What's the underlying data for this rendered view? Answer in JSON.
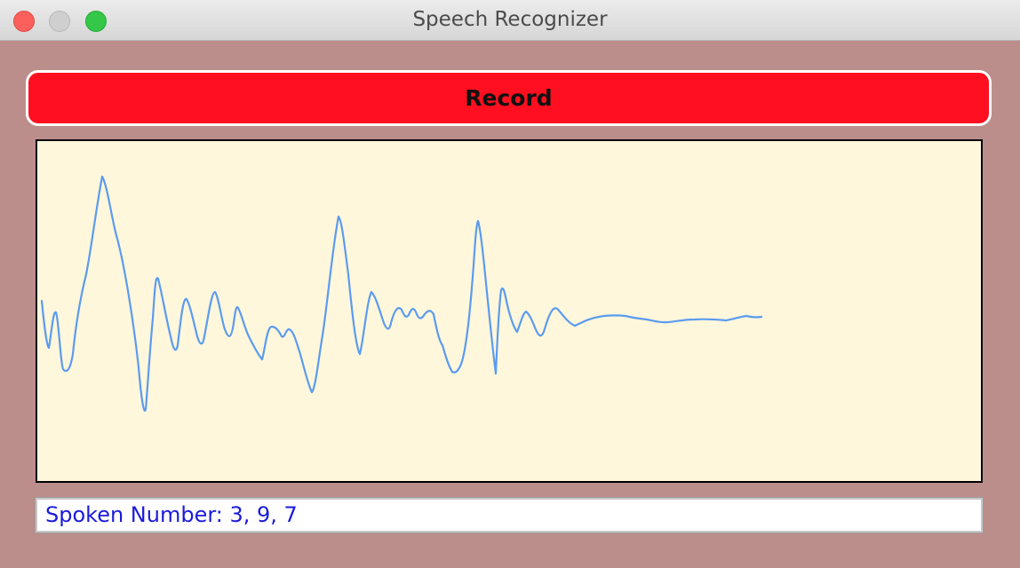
{
  "window": {
    "title": "Speech Recognizer"
  },
  "record_button": {
    "label": "Record"
  },
  "result": {
    "text": "Spoken Number: 3, 9, 7"
  },
  "colors": {
    "window_background": "#bb8e8c",
    "record_button": "#ff0f1f",
    "waveform_background": "#fff7dc",
    "waveform_line": "#5b9bef",
    "result_text": "#1b1bd8"
  }
}
